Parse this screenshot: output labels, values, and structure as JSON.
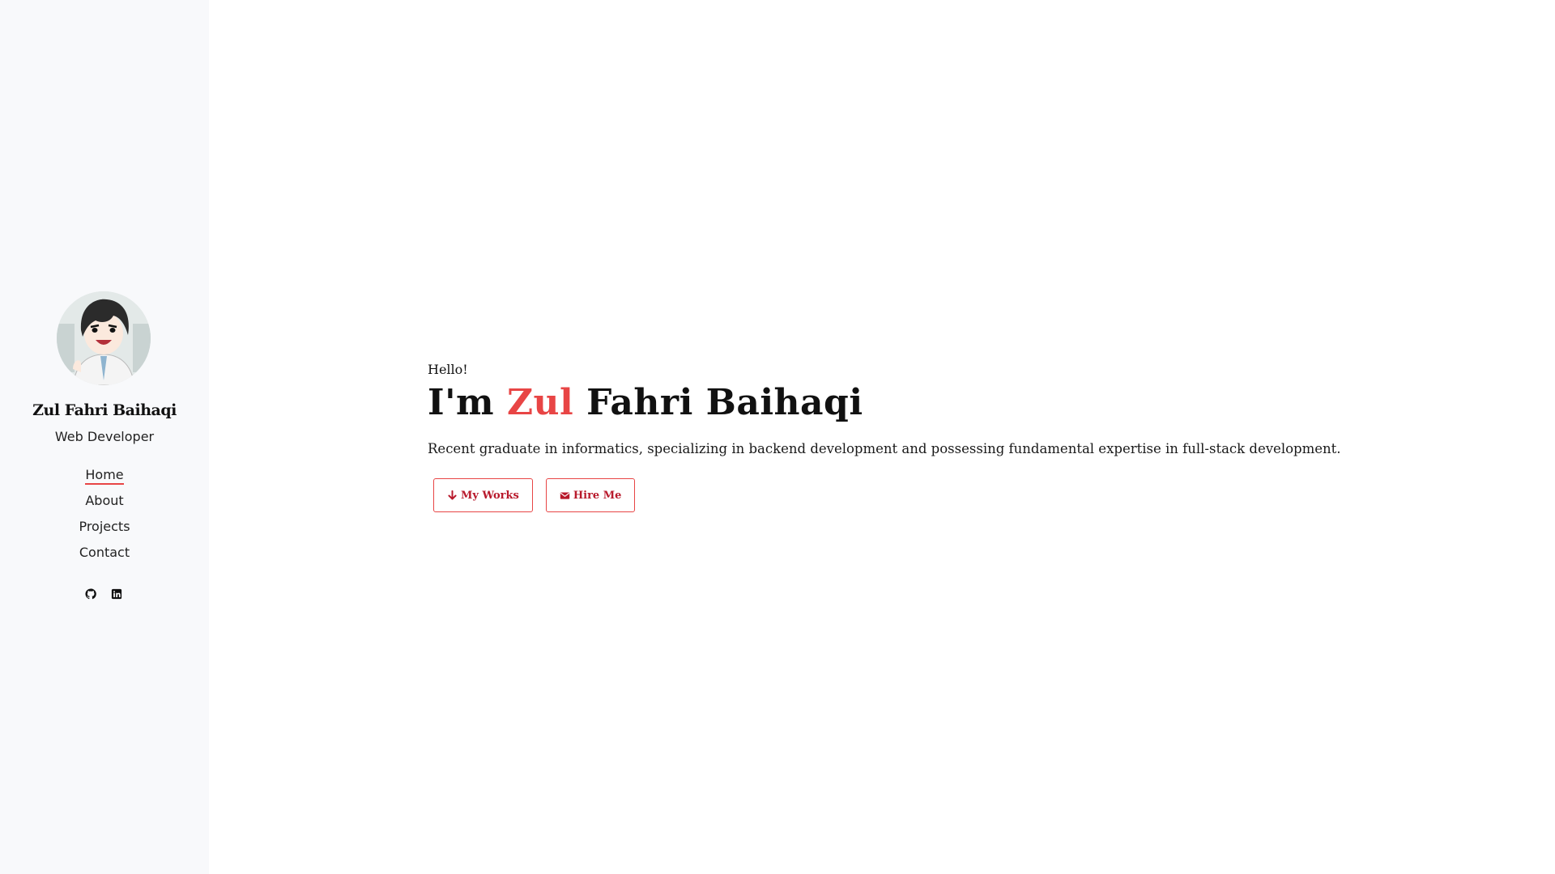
{
  "sidebar": {
    "name": "Zul Fahri Baihaqi",
    "role": "Web Developer",
    "nav": [
      {
        "label": "Home",
        "active": true
      },
      {
        "label": "About",
        "active": false
      },
      {
        "label": "Projects",
        "active": false
      },
      {
        "label": "Contact",
        "active": false
      }
    ],
    "social": [
      "github-icon",
      "linkedin-icon"
    ]
  },
  "hero": {
    "greeting": "Hello!",
    "prefix": "I'm",
    "first_name": "Zul",
    "last_name": "Fahri Baihaqi",
    "tagline": "Recent graduate in informatics, specializing in backend development and possessing fundamental expertise in full-stack development.",
    "buttons": {
      "works": "My Works",
      "hire": "Hire Me"
    }
  },
  "colors": {
    "accent": "#e84545",
    "button_text": "#b8192b",
    "sidebar_bg": "#f8f9fb"
  }
}
